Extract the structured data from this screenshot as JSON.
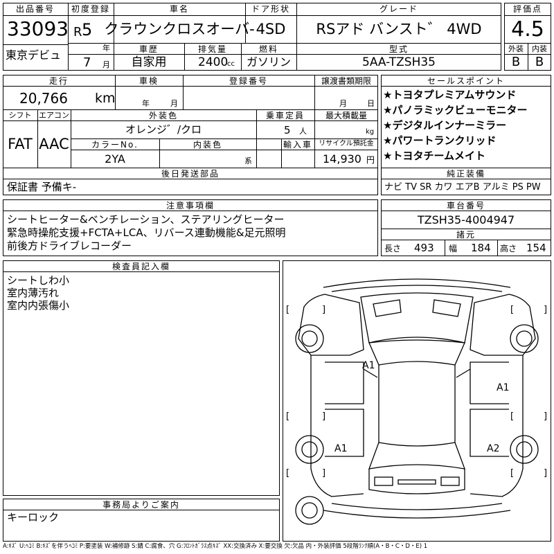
{
  "header": {
    "lot_label": "出品番号",
    "lot": "33093",
    "auction": "東京デビュ",
    "first_reg_label": "初度登録",
    "era": "R",
    "year": "5",
    "year_unit": "年",
    "month": "7",
    "month_unit": "月",
    "name_label": "車名",
    "name": "クラウンクロスオーバ-",
    "door_label": "ドア形状",
    "door": "4SD",
    "grade_label": "グレード",
    "grade": "RSアド バンスト゛ 4WD",
    "score_label": "評価点",
    "score": "4.5",
    "ext_label": "外装",
    "ext": "B",
    "int_label": "内装",
    "int": "B",
    "history_label": "車歴",
    "history": "自家用",
    "disp_label": "排気量",
    "disp": "2400",
    "disp_unit": "cc",
    "fuel_label": "燃料",
    "fuel": "ガソリン",
    "model_label": "型式",
    "model": "5AA-TZSH35"
  },
  "specs": {
    "mileage_label": "走行",
    "mileage": "20,766",
    "mileage_unit": "km",
    "inspection_label": "車検",
    "insp_year": "年",
    "insp_month": "月",
    "regno_label": "登録番号",
    "deadline_label": "譲渡書類期限",
    "dl_month": "月",
    "dl_day": "日",
    "shift_label": "シフト",
    "shift": "FAT",
    "ac_label": "エアコン",
    "ac": "AAC",
    "ext_color_label": "外装色",
    "ext_color": "オレンジ゛/クロ",
    "capacity_label": "乗車定員",
    "capacity": "5",
    "capacity_unit": "人",
    "load_label": "最大積載量",
    "load_unit": "kg",
    "color_no_label": "カラーNo.",
    "color_no": "2YA",
    "int_color_label": "内装色",
    "int_color_unit": "系",
    "import_label": "輸入車",
    "recycle_label": "リサイクル預託金",
    "recycle": "14,930",
    "recycle_unit": "円",
    "later_label": "後日発送部品",
    "later": "保証書 予備キ-"
  },
  "sales": {
    "label": "セールスポイント",
    "items": [
      "★トヨタプレミアムサウンド",
      "★パノラミックビューモニター",
      "★デジタルインナーミラー",
      "★パワートランクリッド",
      "★トヨタチームメイト"
    ],
    "equip_label": "純正装備",
    "equip": "ナビ TV SR カワ エアB アルミ PS PW"
  },
  "notes": {
    "label": "注意事項欄",
    "lines": [
      "シートヒーター&ベンチレーション、ステアリングヒーター",
      "緊急時操舵支援+FCTA+LCA、リバース連動機能&足元照明",
      "前後方ドライブレコーダー"
    ]
  },
  "chassis": {
    "label": "車台番号",
    "number": "TZSH35-4004947",
    "dims_label": "諸元",
    "len_label": "長さ",
    "len": "493",
    "wid_label": "幅",
    "wid": "184",
    "hgt_label": "高さ",
    "hgt": "154"
  },
  "inspector": {
    "label": "検査員記入欄",
    "lines": [
      "シートしわ小",
      "室内薄汚れ",
      "室内内張傷小"
    ]
  },
  "office": {
    "label": "事務局よりご案内",
    "text": "キーロック"
  },
  "diagram": {
    "marks": [
      "A1",
      "A1",
      "A1",
      "A2"
    ],
    "bracket_open": "[",
    "bracket_close": "]"
  },
  "legend": "A:ｷｽﾞ U:ﾍｺﾐ B:ｷｽﾞを伴うﾍｺﾐ P:要塗装 W:補修跡 S:錆 C:腐食、穴 G:ﾌﾛﾝﾄｶﾞﾗｽ点ｷｽﾞ XX:交換済み X:要交換 欠:欠品 内・外装評価 5段階ﾗﾝｸ順(A・B・C・D・E) 1"
}
